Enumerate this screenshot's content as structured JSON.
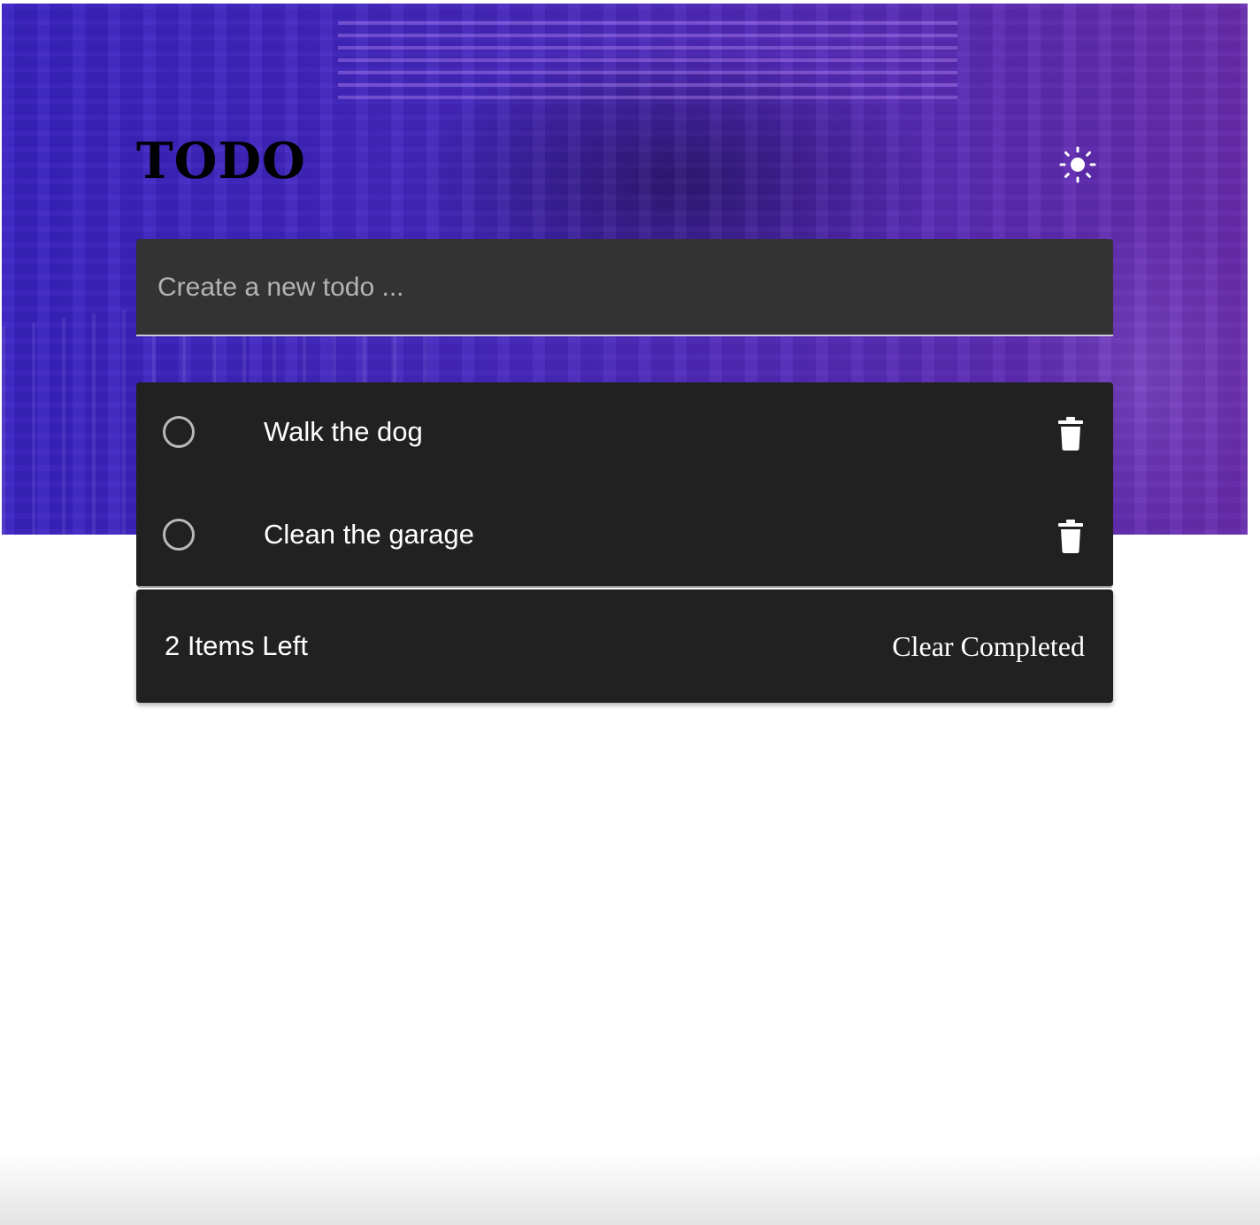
{
  "header": {
    "title": "TODO",
    "theme_toggle_icon": "sun-icon"
  },
  "new_todo": {
    "placeholder": "Create a new todo ...",
    "value": ""
  },
  "todos": [
    {
      "text": "Walk the dog",
      "completed": false,
      "delete_icon": "trash-icon"
    },
    {
      "text": "Clean the garage",
      "completed": false,
      "delete_icon": "trash-icon"
    }
  ],
  "footer": {
    "items_left": "2 Items Left",
    "clear_label": "Clear Completed"
  },
  "colors": {
    "hero_start": "#3a22c4",
    "hero_end": "#6a2db0",
    "input_bg": "#333333",
    "card_bg": "#212121",
    "text": "#ffffff"
  }
}
